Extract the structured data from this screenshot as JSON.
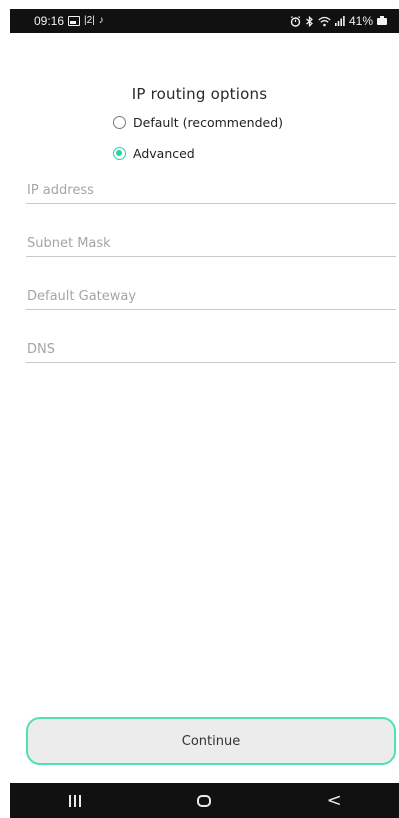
{
  "status_bar": {
    "time": "09:16",
    "left_icons": [
      "gallery-icon",
      "sim-2-icon",
      "tiktok-icon"
    ],
    "sim_label": "|2|",
    "tiktok_glyph": "♪",
    "right_icons": [
      "alarm-icon",
      "bluetooth-icon",
      "wifi-icon",
      "signal-icon",
      "battery-icon"
    ],
    "battery_percent": "41%"
  },
  "page": {
    "title": "IP routing options"
  },
  "routing_options": [
    {
      "label": "Default (recommended)",
      "selected": false
    },
    {
      "label": "Advanced",
      "selected": true
    }
  ],
  "fields": {
    "ip_address": {
      "placeholder": "IP address",
      "value": ""
    },
    "subnet_mask": {
      "placeholder": "Subnet Mask",
      "value": ""
    },
    "default_gateway": {
      "placeholder": "Default Gateway",
      "value": ""
    },
    "dns": {
      "placeholder": "DNS",
      "value": ""
    }
  },
  "actions": {
    "continue_label": "Continue"
  },
  "nav": {
    "back_glyph": "<"
  },
  "colors": {
    "accent": "#27d3a5",
    "button_border": "#4fe0b6",
    "button_bg": "#ececec",
    "system_bar": "#111111"
  }
}
